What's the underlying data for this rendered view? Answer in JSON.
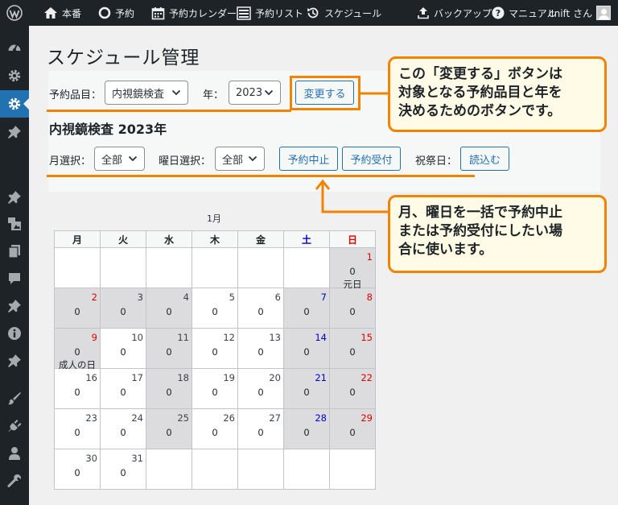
{
  "adminbar": {
    "site_label": "本番",
    "reserve_label": "予約",
    "calendar_label": "予約カレンダー",
    "list_label": "予約リスト",
    "schedule_label": "スケジュール",
    "backup_label": "バックアップ",
    "manual_label": "マニュアル",
    "user_label": "cnift さん"
  },
  "sidebar": {
    "items": [
      {
        "icon": "dashboard-icon"
      },
      {
        "icon": "gear-icon"
      },
      {
        "icon": "gear-icon",
        "active": true
      },
      {
        "icon": "pin-icon"
      },
      {
        "icon": "pin-icon"
      },
      {
        "icon": "media-icon"
      },
      {
        "icon": "pages-icon"
      },
      {
        "icon": "comment-icon"
      },
      {
        "icon": "pin-icon"
      },
      {
        "icon": "info-icon"
      },
      {
        "icon": "pin-icon"
      },
      {
        "icon": "brush-icon"
      },
      {
        "icon": "plugin-icon"
      },
      {
        "icon": "user-icon"
      },
      {
        "icon": "wrench-icon"
      }
    ]
  },
  "page": {
    "title": "スケジュール管理",
    "item_label": "予約品目：",
    "item_value": "内視鏡検査",
    "year_label": "年：",
    "year_value": "2023",
    "change_button": "変更する",
    "subtitle": "内視鏡検査 2023年",
    "month_label": "月選択：",
    "month_value": "全部",
    "weekday_label": "曜日選択：",
    "weekday_value": "全部",
    "stop_button": "予約中止",
    "accept_button": "予約受付",
    "holiday_label": "祝祭日：",
    "load_button": "読込む"
  },
  "callouts": {
    "top": [
      "この「変更する」ボタンは",
      "対象となる予約品目と年を",
      "決めるためのボタンです。"
    ],
    "bottom": [
      "月、曜日を一括で予約中止",
      "または予約受付にしたい場",
      "合に使います。"
    ]
  },
  "calendar": {
    "month": "1月",
    "headers": [
      "月",
      "火",
      "水",
      "木",
      "金",
      "土",
      "日"
    ],
    "weeks": [
      [
        null,
        null,
        null,
        null,
        null,
        null,
        {
          "day": "1",
          "count": "0",
          "holiday": "元日",
          "gray": true
        }
      ],
      [
        {
          "day": "2",
          "count": "0",
          "gray": true,
          "red": true
        },
        {
          "day": "3",
          "count": "0",
          "gray": true
        },
        {
          "day": "4",
          "count": "0",
          "gray": true
        },
        {
          "day": "5",
          "count": "0"
        },
        {
          "day": "6",
          "count": "0"
        },
        {
          "day": "7",
          "count": "0",
          "gray": true
        },
        {
          "day": "8",
          "count": "0",
          "gray": true
        }
      ],
      [
        {
          "day": "9",
          "count": "0",
          "holiday": "成人の日",
          "gray": true,
          "red": true
        },
        {
          "day": "10",
          "count": "0"
        },
        {
          "day": "11",
          "count": "0",
          "gray": true
        },
        {
          "day": "12",
          "count": "0"
        },
        {
          "day": "13",
          "count": "0"
        },
        {
          "day": "14",
          "count": "0",
          "gray": true
        },
        {
          "day": "15",
          "count": "0",
          "gray": true
        }
      ],
      [
        {
          "day": "16",
          "count": "0"
        },
        {
          "day": "17",
          "count": "0"
        },
        {
          "day": "18",
          "count": "0",
          "gray": true
        },
        {
          "day": "19",
          "count": "0"
        },
        {
          "day": "20",
          "count": "0"
        },
        {
          "day": "21",
          "count": "0",
          "gray": true
        },
        {
          "day": "22",
          "count": "0",
          "gray": true
        }
      ],
      [
        {
          "day": "23",
          "count": "0"
        },
        {
          "day": "24",
          "count": "0"
        },
        {
          "day": "25",
          "count": "0",
          "gray": true
        },
        {
          "day": "26",
          "count": "0"
        },
        {
          "day": "27",
          "count": "0"
        },
        {
          "day": "28",
          "count": "0",
          "gray": true
        },
        {
          "day": "29",
          "count": "0",
          "gray": true
        }
      ],
      [
        {
          "day": "30",
          "count": "0"
        },
        {
          "day": "31",
          "count": "0"
        },
        null,
        null,
        null,
        null,
        null
      ]
    ]
  },
  "colors": {
    "adminbar_bg": "#1d2327",
    "accent": "#2271b1",
    "callout_border": "#f08300",
    "callout_bg": "#fffbe6",
    "saturday": "#0000cc",
    "sunday": "#dd0000",
    "closed_day": "#dcdcde"
  }
}
